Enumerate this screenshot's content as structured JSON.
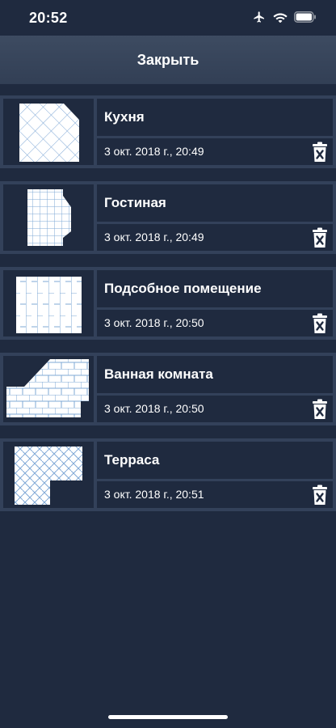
{
  "status_bar": {
    "time": "20:52",
    "icons": [
      "airplane-icon",
      "wifi-icon",
      "battery-icon"
    ]
  },
  "header": {
    "close_label": "Закрыть"
  },
  "rooms": [
    {
      "name": "Кухня",
      "date": "3 окт. 2018 г., 20:49",
      "thumbnail": "diagonal-grid-tiles"
    },
    {
      "name": "Гостиная",
      "date": "3 окт. 2018 г., 20:49",
      "thumbnail": "square-grid-tiles"
    },
    {
      "name": "Подсобное помещение",
      "date": "3 окт. 2018 г., 20:50",
      "thumbnail": "vertical-brick-tiles"
    },
    {
      "name": "Ванная комната",
      "date": "3 окт. 2018 г., 20:50",
      "thumbnail": "horizontal-brick-tiles"
    },
    {
      "name": "Терраса",
      "date": "3 окт. 2018 г., 20:51",
      "thumbnail": "herringbone-tiles"
    }
  ],
  "colors": {
    "background": "#1f2a3f",
    "row_frame": "#33415a",
    "header": "#3d4b61",
    "tile_line": "#7fa8d6"
  }
}
